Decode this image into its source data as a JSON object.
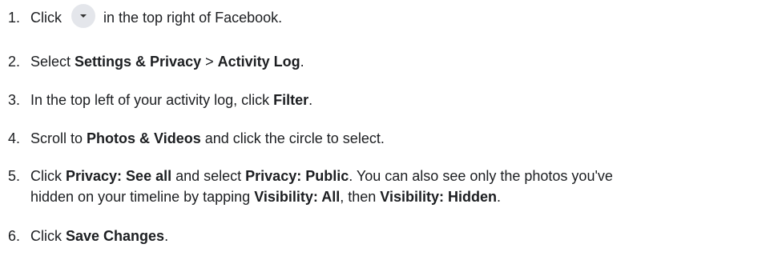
{
  "steps": [
    {
      "number": "1.",
      "parts": [
        "Click",
        "in the top right of Facebook."
      ],
      "icon": "caret-down-icon"
    },
    {
      "number": "2.",
      "parts": [
        "Select ",
        "Settings & Privacy",
        " > ",
        "Activity Log",
        "."
      ]
    },
    {
      "number": "3.",
      "parts": [
        "In the top left of your activity log, click ",
        "Filter",
        "."
      ]
    },
    {
      "number": "4.",
      "parts": [
        "Scroll to ",
        "Photos & Videos",
        " and click the circle to select."
      ]
    },
    {
      "number": "5.",
      "parts": [
        "Click ",
        "Privacy: See all",
        " and select ",
        "Privacy: Public",
        ". You can also see only the photos you've",
        "hidden on your timeline by tapping ",
        "Visibility: All",
        ", then ",
        "Visibility: Hidden",
        "."
      ]
    },
    {
      "number": "6.",
      "parts": [
        "Click ",
        "Save Changes",
        "."
      ]
    }
  ]
}
